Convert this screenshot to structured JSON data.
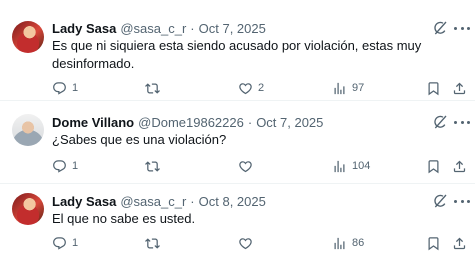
{
  "tweets": [
    {
      "name": "Lady Sasa",
      "handle": "@sasa_c_r",
      "separator": "·",
      "date": "Oct 7, 2025",
      "text": "Es que ni siquiera esta siendo acusado por violación, estas muy desinformado.",
      "replies": "1",
      "retweets": "",
      "likes": "2",
      "views": "97"
    },
    {
      "name": "Dome Villano",
      "handle": "@Dome19862226",
      "separator": "·",
      "date": "Oct 7, 2025",
      "text": "¿Sabes que es una violación?",
      "replies": "1",
      "retweets": "",
      "likes": "",
      "views": "104"
    },
    {
      "name": "Lady Sasa",
      "handle": "@sasa_c_r",
      "separator": "·",
      "date": "Oct 8, 2025",
      "text": "El que no sabe es usted.",
      "replies": "1",
      "retweets": "",
      "likes": "",
      "views": "86"
    }
  ],
  "icons": {
    "reply": "reply-icon",
    "retweet": "retweet-icon",
    "like": "heart-icon",
    "views": "views-icon",
    "bookmark": "bookmark-icon",
    "share": "share-icon",
    "grok": "grok-icon",
    "more": "more-icon"
  },
  "colors": {
    "text": "#0f1419",
    "secondary": "#536471",
    "divider": "#eff3f4"
  }
}
